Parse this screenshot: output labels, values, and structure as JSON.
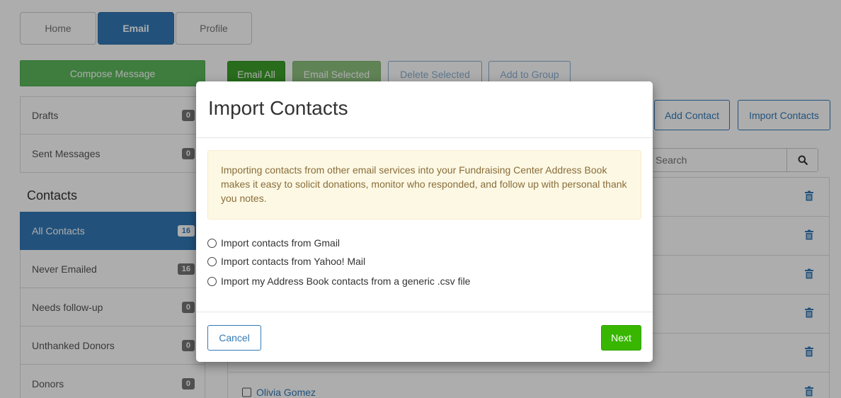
{
  "nav": {
    "tabs": [
      {
        "label": "Home"
      },
      {
        "label": "Email"
      },
      {
        "label": "Profile"
      }
    ]
  },
  "sidebar": {
    "compose_label": "Compose Message",
    "items_top": [
      {
        "label": "Drafts",
        "count": "0"
      },
      {
        "label": "Sent Messages",
        "count": "0"
      }
    ],
    "contacts_heading": "Contacts",
    "items_contacts": [
      {
        "label": "All Contacts",
        "count": "16"
      },
      {
        "label": "Never Emailed",
        "count": "16"
      },
      {
        "label": "Needs follow-up",
        "count": "0"
      },
      {
        "label": "Unthanked Donors",
        "count": "0"
      },
      {
        "label": "Donors",
        "count": "0"
      }
    ]
  },
  "toolbar": {
    "email_all": "Email All",
    "email_selected": "Email Selected",
    "delete_selected": "Delete Selected",
    "add_to_group": "Add to Group",
    "add_contact": "Add Contact",
    "import_contacts": "Import Contacts"
  },
  "search": {
    "placeholder": "Search"
  },
  "contacts": {
    "visible_name": "Olivia Gomez"
  },
  "modal": {
    "title": "Import Contacts",
    "alert_text": "Importing contacts from other email services into your Fundraising Center Address Book makes it easy to solicit donations, monitor who responded, and follow up with personal thank you notes.",
    "options": [
      {
        "label": "Import contacts from Gmail"
      },
      {
        "label": "Import contacts from Yahoo! Mail"
      },
      {
        "label": "Import my Address Book contacts from a generic .csv file"
      }
    ],
    "cancel_label": "Cancel",
    "next_label": "Next"
  },
  "colors": {
    "primary": "#337ab7",
    "success": "#5cb85c",
    "next_green": "#38b600",
    "alert_bg": "#fcf8e3",
    "alert_text": "#8a6d3b"
  },
  "icons": {
    "search": "search-icon",
    "trash": "trash-icon"
  }
}
